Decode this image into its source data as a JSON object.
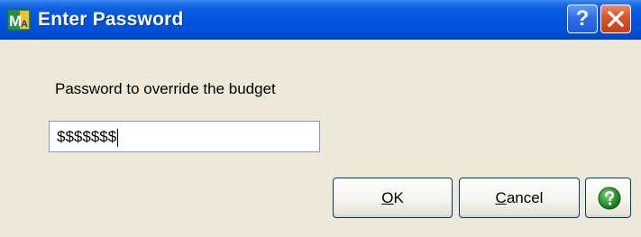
{
  "window": {
    "title": "Enter Password",
    "app_icon": "mas90-app-icon",
    "help_glyph": "?",
    "close_icon": "close-x-icon"
  },
  "dialog": {
    "prompt": "Password to override the budget",
    "password_value": "$$$$$$$"
  },
  "buttons": {
    "ok_mnemonic": "O",
    "ok_rest": "K",
    "cancel_mnemonic": "C",
    "cancel_rest": "ancel",
    "help_icon": "green-question-circle-icon"
  },
  "colors": {
    "title_bar": "#0055dd",
    "close_button": "#d9542c",
    "dialog_background": "#ece9d8",
    "help_circle": "#2f9b2f"
  }
}
